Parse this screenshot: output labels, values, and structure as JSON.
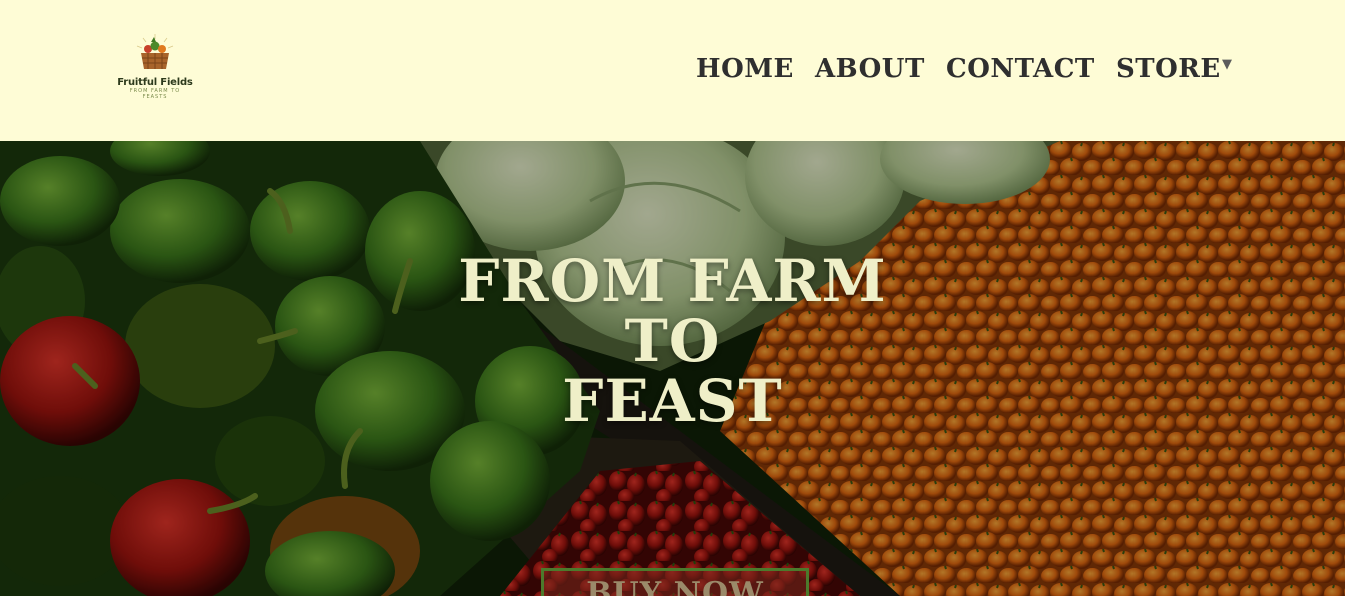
{
  "logo": {
    "name": "Fruitful Fields",
    "tagline": "FROM FARM TO FEASTS",
    "icon": "basket-of-vegetables-icon"
  },
  "nav": {
    "items": [
      {
        "label": "HOME"
      },
      {
        "label": "ABOUT"
      },
      {
        "label": "CONTACT"
      },
      {
        "label": "STORE"
      }
    ],
    "store_caret": "▼"
  },
  "hero": {
    "title_lines": [
      "FROM FARM",
      "TO",
      "FEAST"
    ],
    "button_label": "BUY NOW",
    "background": "vegetables-market-photo"
  },
  "colors": {
    "header_bg": "#fefcd6",
    "nav_text": "#2f2f2f",
    "hero_title": "#efefc8",
    "button_border": "#4c7a2c"
  }
}
